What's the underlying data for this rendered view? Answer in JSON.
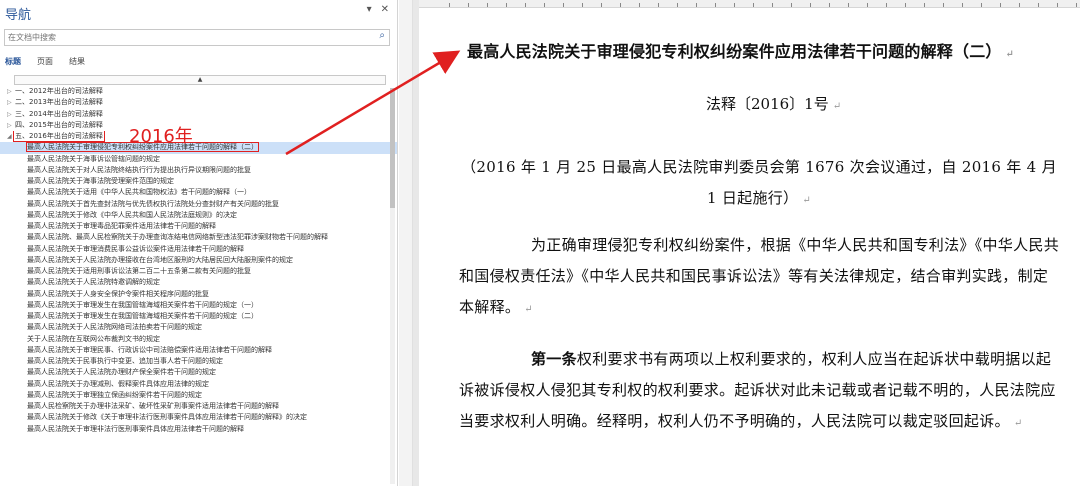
{
  "nav": {
    "title": "导航",
    "pin_glyph": "▾",
    "close_glyph": "✕",
    "search_placeholder": "在文档中搜索",
    "search_icon_glyph": "⌕",
    "tabs": [
      "标题",
      "页面",
      "结果"
    ],
    "active_tab": "标题",
    "scroll_up_glyph": "▲",
    "top_items": [
      {
        "label": "一、2012年出台的司法解释",
        "expanded": false
      },
      {
        "label": "二、2013年出台的司法解释",
        "expanded": false
      },
      {
        "label": "三、2014年出台的司法解释",
        "expanded": false
      },
      {
        "label": "四、2015年出台的司法解释",
        "expanded": false
      },
      {
        "label": "五、2016年出台的司法解释",
        "expanded": true
      }
    ],
    "children": [
      "最高人民法院关于审理侵犯专利权纠纷案件应用法律若干问题的解释（二）",
      "最高人民法院关于海事诉讼管辖问题的规定",
      "最高人民法院关于对人民法院终结执行行为提出执行异议期限问题的批复",
      "最高人民法院关于海事法院受理案件范围的规定",
      "最高人民法院关于适用《中华人民共和国物权法》若干问题的解释（一）",
      "最高人民法院关于首先查封法院与优先债权执行法院处分查封财产有关问题的批复",
      "最高人民法院关于修改《中华人民共和国人民法院法庭规则》的决定",
      "最高人民法院关于审理毒品犯罪案件适用法律若干问题的解释",
      "最高人民法院、最高人民检察院关于办理查询冻结电信网络新型违法犯罪涉案财物若干问题的解释",
      "最高人民法院关于审理消费民事公益诉讼案件适用法律若干问题的解释",
      "最高人民法院关于人民法院办理接收在台湾地区服刑的大陆居民回大陆服刑案件的规定",
      "最高人民法院关于适用刑事诉讼法第二百二十五条第二款有关问题的批复",
      "最高人民法院关于人民法院特邀调解的规定",
      "最高人民法院关于人身安全保护令案件相关程序问题的批复",
      "最高人民法院关于审理发生在我国管辖海域相关案件若干问题的规定（一）",
      "最高人民法院关于审理发生在我国管辖海域相关案件若干问题的规定（二）",
      "最高人民法院关于人民法院网络司法拍卖若干问题的规定",
      "关于人民法院在互联网公布裁判文书的规定",
      "最高人民法院关于审理民事、行政诉讼中司法赔偿案件适用法律若干问题的解释",
      "最高人民法院关于民事执行中变更、追加当事人若干问题的规定",
      "最高人民法院关于人民法院办理财产保全案件若干问题的规定",
      "最高人民法院关于办理减刑、假释案件具体应用法律的规定",
      "最高人民法院关于审理独立保函纠纷案件若干问题的规定",
      "最高人民检察院关于办理非法采矿、破坏性采矿刑事案件适用法律若干问题的解释",
      "最高人民法院关于修改《关于审理非法行医刑事案件具体应用法律若干问题的解释》的决定",
      "最高人民法院关于审理非法行医刑事案件具体应用法律若干问题的解释"
    ],
    "selected_child_index": 0,
    "annotation": "2016年",
    "annotation_color": "#e02020",
    "selection_color": "#cce0f8"
  },
  "document": {
    "title": "最高人民法院关于审理侵犯专利权纠纷案件应用法律若干问题的解释（二）",
    "doc_number": "法释〔2016〕1号",
    "note": "（2016 年 1 月 25 日最高人民法院审判委员会第 1676 次会议通过，自 2016 年 4 月 1 日起施行）",
    "para1": "为正确审理侵犯专利权纠纷案件，根据《中华人民共和国专利法》《中华人民共和国侵权责任法》《中华人民共和国民事诉讼法》等有关法律规定，结合审判实践，制定本解释。",
    "para2_lead": "第一条",
    "para2_rest": "权利要求书有两项以上权利要求的，权利人应当在起诉状中载明据以起诉被诉侵权人侵犯其专利权的权利要求。起诉状对此未记载或者记载不明的，人民法院应当要求权利人明确。经释明，权利人仍不予明确的，人民法院可以裁定驳回起诉。",
    "para_mark": "↵"
  }
}
